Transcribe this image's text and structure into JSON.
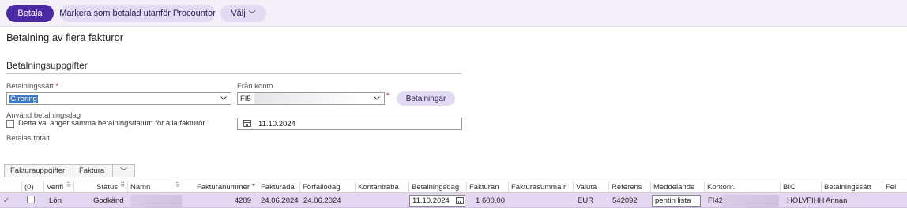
{
  "toolbar": {
    "pay_label": "Betala",
    "mark_paid_label": "Markera som betalad utanför Procountor",
    "choose_label": "Välj",
    "choose_chevron": "﹀"
  },
  "page": {
    "title": "Betalning av flera fakturor"
  },
  "payment_details": {
    "section_title": "Betalningsuppgifter",
    "method_label": "Betalningssätt",
    "method_required_mark": "*",
    "method_value": "Girering",
    "from_account_label": "Från konto",
    "from_account_value": "FI5",
    "from_account_required_mark": "*",
    "payments_button_label": "Betalningar",
    "use_date_label": "Använd betalningsdag",
    "same_date_checkbox_label": "Detta val anger samma betalningsdatum för alla fakturor",
    "same_date_checked": false,
    "date_value": "11.10.2024",
    "total_label": "Betalas totalt"
  },
  "tabs": {
    "invoice_details_label": "Fakturauppgifter",
    "invoice_label": "Faktura",
    "dropdown_chevron": "﹀"
  },
  "grid": {
    "columns": {
      "selected": "(0)",
      "verif": "Verifi",
      "status": "Status",
      "namn": "Namn",
      "fakturanummer": "Fakturanummer",
      "fakturadatum": "Fakturada",
      "forfallodag": "Förfallodag",
      "kontantrabatt": "Kontantraba",
      "betalningsdag": "Betalningsdag",
      "fakturan": "Fakturan",
      "fakturasumma": "Fakturasumma r",
      "valuta": "Valuta",
      "referens": "Referens",
      "meddelande": "Meddelande",
      "kontonr": "Kontonr.",
      "bic": "BIC",
      "betalningssatt": "Betalningssätt",
      "fel": "Fel"
    },
    "rows": [
      {
        "check_mark": "✓",
        "verif": "Lön",
        "status": "Godkänd",
        "fakturanummer": "4209",
        "fakturadatum": "24.06.2024",
        "forfallodag": "24.06.2024",
        "betalningsdag": "11.10.2024",
        "belopp": "1 600,00",
        "valuta": "EUR",
        "referens": "542092",
        "meddelande": "pentin lista",
        "kontonr": "FI42",
        "bic": "HOLVFIHH",
        "betalningssatt": "Annan"
      }
    ]
  },
  "colors": {
    "primary": "#4b2aa6",
    "secondary_pill": "#e3daf4",
    "selected_row": "#e4d7f2",
    "required": "#c8102e",
    "selection_highlight": "#3c76c9"
  }
}
